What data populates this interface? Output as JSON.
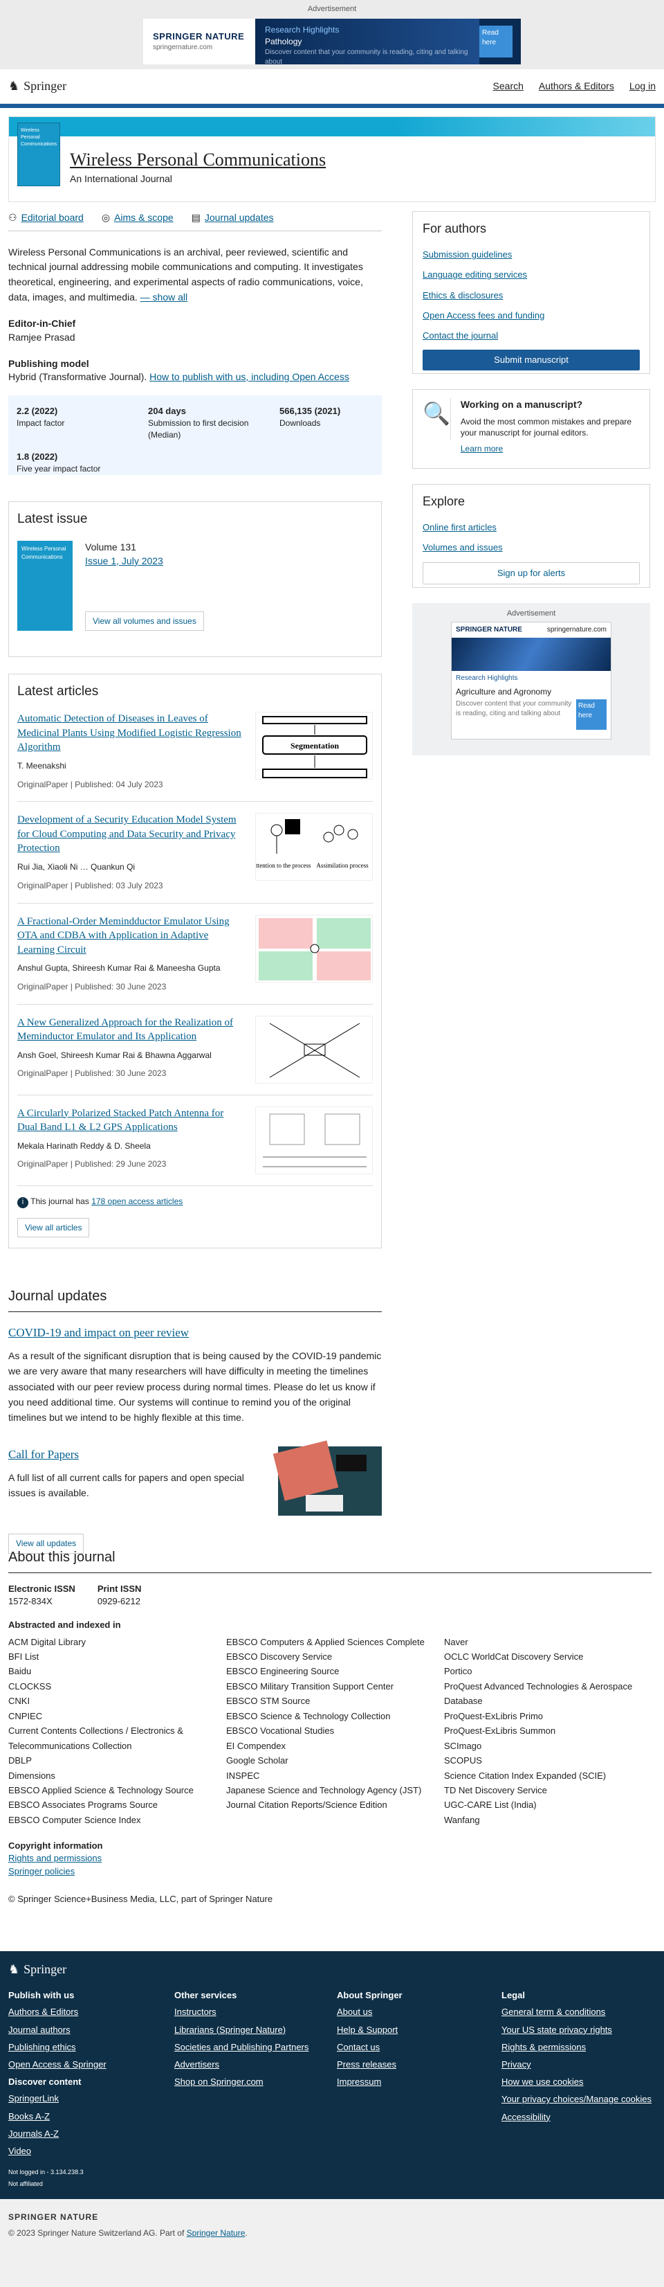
{
  "ad_top": {
    "label": "Advertisement",
    "brand": "SPRINGER NATURE",
    "url": "springernature.com",
    "line1": "Research Highlights",
    "line2": "Pathology",
    "line3": "Discover content that your community is reading, citing and talking about",
    "btn": "Read here"
  },
  "header": {
    "logo": "Springer",
    "search": "Search",
    "authors": "Authors & Editors",
    "login": "Log in"
  },
  "journal": {
    "title": "Wireless Personal Communications",
    "subtitle": "An International Journal",
    "cover_text": "Wireless Personal Communications"
  },
  "nav": {
    "editorial": "Editorial board",
    "aims": "Aims & scope",
    "updates": "Journal updates"
  },
  "description": "Wireless Personal Communications is an archival, peer reviewed, scientific and technical journal addressing mobile communications and computing. It investigates theoretical, engineering, and experimental aspects of radio communications, voice, data, images, and multimedia.",
  "show_all": "— show all",
  "editor": {
    "label": "Editor-in-Chief",
    "name": "Ramjee Prasad"
  },
  "model": {
    "label": "Publishing model",
    "value": "Hybrid (Transformative Journal).",
    "link": "How to publish with us, including Open Access"
  },
  "metrics": [
    {
      "v": "2.2 (2022)",
      "l": "Impact factor"
    },
    {
      "v": "204 days",
      "l": "Submission to first decision (Median)"
    },
    {
      "v": "566,135 (2021)",
      "l": "Downloads"
    },
    {
      "v": "1.8 (2022)",
      "l": "Five year impact factor"
    }
  ],
  "authors_box": {
    "title": "For authors",
    "links": [
      "Submission guidelines",
      "Language editing services",
      "Ethics & disclosures",
      "Open Access fees and funding",
      "Contact the journal"
    ],
    "button": "Submit manuscript"
  },
  "manuscript": {
    "title": "Working on a manuscript?",
    "text": "Avoid the most common mistakes and prepare your manuscript for journal editors.",
    "link": "Learn more"
  },
  "explore": {
    "title": "Explore",
    "links": [
      "Online first articles",
      "Volumes and issues"
    ],
    "button": "Sign up for alerts"
  },
  "ad_side": {
    "label": "Advertisement",
    "brand": "SPRINGER NATURE",
    "url": "springernature.com",
    "line1": "Research Highlights",
    "line2": "Agriculture and Agronomy",
    "line3": "Discover content that your community is reading, citing and talking about",
    "btn": "Read here"
  },
  "latest_issue": {
    "title": "Latest issue",
    "volume": "Volume 131",
    "issue": "Issue 1, July 2023",
    "button": "View all volumes and issues"
  },
  "latest_articles": {
    "title": "Latest articles",
    "items": [
      {
        "title": "Automatic Detection of Diseases in Leaves of Medicinal Plants Using Modified Logistic Regression Algorithm",
        "authors": "T. Meenakshi",
        "type": "OriginalPaper",
        "date": "Published: 04 July 2023"
      },
      {
        "title": "Development of a Security Education Model System for Cloud Computing and Data Security and Privacy Protection",
        "authors": "Rui Jia, Xiaoli Ni … Quankun Qi",
        "type": "OriginalPaper",
        "date": "Published: 03 July 2023"
      },
      {
        "title": "A Fractional-Order Memindductor Emulator Using OTA and CDBA with Application in Adaptive Learning Circuit",
        "authors": "Anshul Gupta, Shireesh Kumar Rai & Maneesha Gupta",
        "type": "OriginalPaper",
        "date": "Published: 30 June 2023"
      },
      {
        "title": "A New Generalized Approach for the Realization of Meminductor Emulator and Its Application",
        "authors": "Ansh Goel, Shireesh Kumar Rai & Bhawna Aggarwal",
        "type": "OriginalPaper",
        "date": "Published: 30 June 2023"
      },
      {
        "title": "A Circularly Polarized Stacked Patch Antenna for Dual Band L1 & L2 GPS Applications",
        "authors": "Mekala Harinath Reddy & D. Sheela",
        "type": "OriginalPaper",
        "date": "Published: 29 June 2023"
      }
    ],
    "fig1": "Segmentation",
    "fig2a": "Pay attention to the process",
    "fig2b": "Assimilation process",
    "oa_pre": "This journal has",
    "oa_link": "178 open access articles",
    "button": "View all articles"
  },
  "journal_updates": {
    "title": "Journal updates",
    "u1_title": "COVID-19 and impact on peer review",
    "u1_text": "As a result of the significant disruption that is being caused by the COVID-19 pandemic we are very aware that many researchers will have difficulty in meeting the timelines associated with our peer review process during normal times.  Please do let us know if you need additional time. Our systems will continue to remind you of the original timelines but we intend to be highly flexible at this time.",
    "u2_title": "Call for Papers",
    "u2_text": "A full list of all current calls for papers and open special issues is available.",
    "button": "View all updates"
  },
  "about": {
    "title": "About this journal",
    "eissn_l": "Electronic ISSN",
    "eissn": "1572-834X",
    "pissn_l": "Print ISSN",
    "pissn": "0929-6212",
    "idx_label": "Abstracted and indexed in",
    "col1": [
      "ACM Digital Library",
      "BFI List",
      "Baidu",
      "CLOCKSS",
      "CNKI",
      "CNPIEC",
      "Current Contents Collections / Electronics & Telecommunications Collection",
      "DBLP",
      "Dimensions",
      "EBSCO Applied Science & Technology Source",
      "EBSCO Associates Programs Source",
      "EBSCO Computer Science Index"
    ],
    "col2": [
      "EBSCO Computers & Applied Sciences Complete",
      "EBSCO Discovery Service",
      "EBSCO Engineering Source",
      "EBSCO Military Transition Support Center",
      "EBSCO STM Source",
      "EBSCO Science & Technology Collection",
      "EBSCO Vocational Studies",
      "EI Compendex",
      "Google Scholar",
      "INSPEC",
      "Japanese Science and Technology Agency (JST)",
      "Journal Citation Reports/Science Edition"
    ],
    "col3": [
      "Naver",
      "OCLC WorldCat Discovery Service",
      "Portico",
      "ProQuest Advanced Technologies & Aerospace Database",
      "ProQuest-ExLibris Primo",
      "ProQuest-ExLibris Summon",
      "SCImago",
      "SCOPUS",
      "Science Citation Index Expanded (SCIE)",
      "TD Net Discovery Service",
      "UGC-CARE List (India)",
      "Wanfang"
    ],
    "copy_label": "Copyright information",
    "rights": "Rights and permissions",
    "policies": "Springer policies",
    "copyright": "© Springer Science+Business Media, LLC, part of Springer Nature"
  },
  "footer": {
    "logo": "Springer",
    "c1h": "Publish with us",
    "c1": [
      "Authors & Editors",
      "Journal authors",
      "Publishing ethics",
      "Open Access & Springer"
    ],
    "c1h2": "Discover content",
    "c1b": [
      "SpringerLink",
      "Books A-Z",
      "Journals A-Z",
      "Video"
    ],
    "c2h": "Other services",
    "c2": [
      "Instructors",
      "Librarians (Springer Nature)",
      "Societies and Publishing Partners",
      "Advertisers",
      "Shop on Springer.com"
    ],
    "c3h": "About Springer",
    "c3": [
      "About us",
      "Help & Support",
      "Contact us",
      "Press releases",
      "Impressum"
    ],
    "c4h": "Legal",
    "c4": [
      "General term & conditions",
      "Your US state privacy rights",
      "Rights & permissions",
      "Privacy",
      "How we use cookies",
      "Your privacy choices/Manage cookies",
      "Accessibility"
    ],
    "ip": "Not logged in - 3.134.238.3",
    "aff": "Not affiliated"
  },
  "bottom": {
    "brand": "SPRINGER NATURE",
    "copyright_pre": "© 2023 Springer Nature Switzerland AG. Part of",
    "copyright_link": "Springer Nature",
    "copyright_post": "."
  }
}
